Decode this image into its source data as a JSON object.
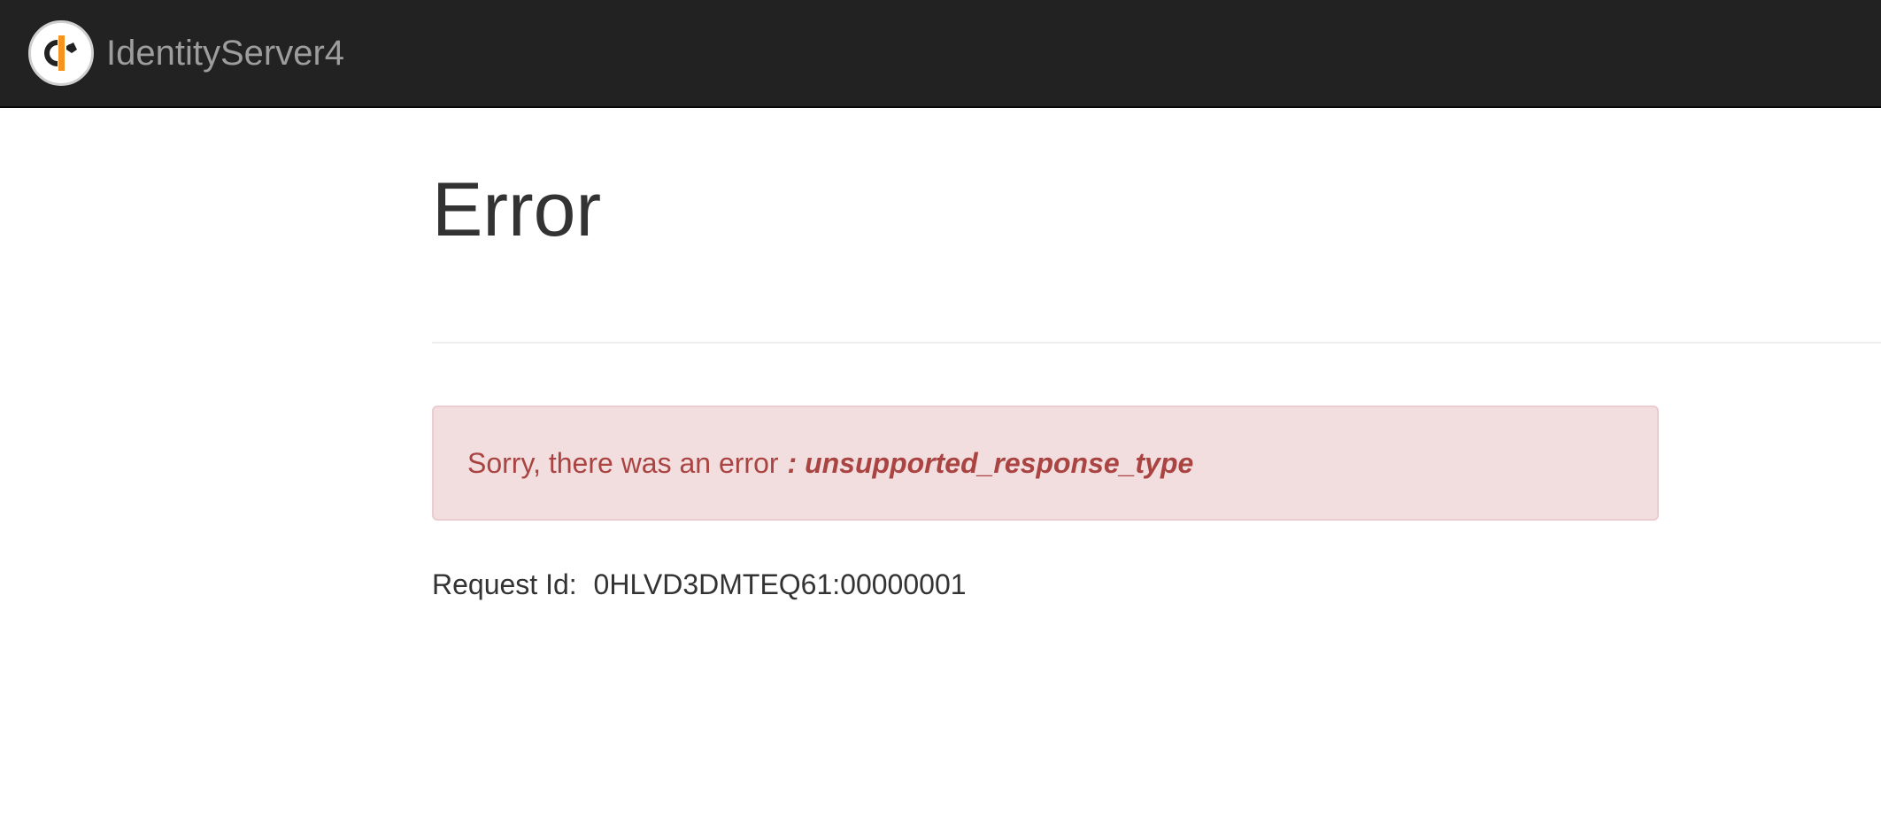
{
  "navbar": {
    "brand_text": "IdentityServer4",
    "logo_icon": "identityserver-logo-icon"
  },
  "main": {
    "title": "Error",
    "alert": {
      "message": "Sorry, there was an error",
      "error_code": ": unsupported_response_type"
    },
    "request": {
      "label": "Request Id:",
      "value": "0HLVD3DMTEQ61:00000001"
    }
  },
  "colors": {
    "navbar_bg": "#222222",
    "alert_bg": "#f2dede",
    "alert_border": "#ebccd1",
    "alert_text": "#a94442",
    "logo_accent": "#f7941d"
  }
}
